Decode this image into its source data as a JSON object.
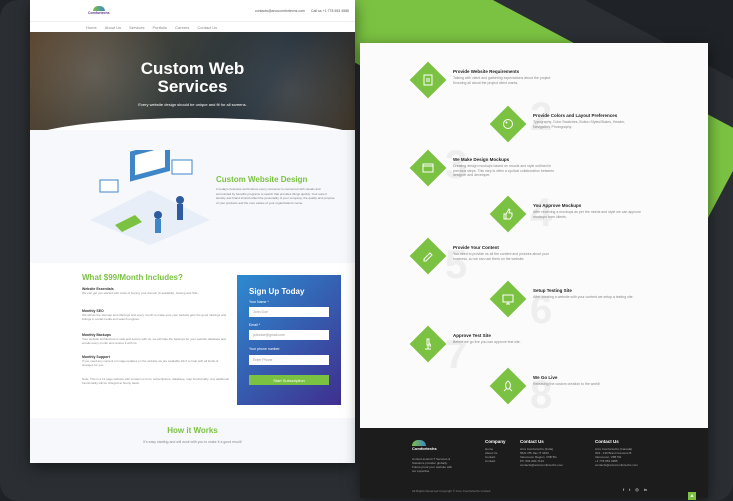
{
  "top": {
    "logo_text": "Comfortechs",
    "email": "contacts@arcocomfortechs.com",
    "phone": "Call us +1 778 953 4985",
    "nav": [
      "Home",
      "About Us",
      "Services",
      "Portfolio",
      "Careers",
      "Contact Us"
    ]
  },
  "hero": {
    "title": "Custom Web Services",
    "subtitle": "Every website design should be unique and fit for all screens."
  },
  "intro": {
    "title": "Custom Website Design",
    "text": "In today's business world where every consumer is concerned with visuals and surrounded by benefits programs to search that provides things quickly. Your expert identity and brand should reflect the personality of your company, the quality and purpose of your products and the core values of your organization's name."
  },
  "includes": {
    "title": "What $99/Month Includes?",
    "features": [
      {
        "name": "Website Essentials",
        "text": "We can get you started with costs of buying your domain (if available), hosting and SSL."
      },
      {
        "name": "Monthly SEO",
        "text": "We will do the sitemap and offerings and every month to make sure your website gets the good rankings and listings in social media and search engines."
      },
      {
        "name": "Monthly Backups",
        "text": "Your website architecture is safe and secure with us, we will take the backups for your website database and emails every month and restore it with us."
      },
      {
        "name": "Monthly Support",
        "text": "If you need any content or image updates on the website we are available 24x7 to help with all kinds of changes for you."
      }
    ],
    "note": "Note: This is a 12 page website with contact us form, subscriptions, database, map functionality. Any additional functionality will be charged at hourly basis."
  },
  "signup": {
    "title": "Sign Up Today",
    "name_label": "Your Name *",
    "name_value": "John Doe",
    "email_label": "Email *",
    "email_value": "johndoe@gmail.com",
    "phone_label": "Your phone number",
    "phone_value": "Enter Phone",
    "button": "Start Subscription"
  },
  "how": {
    "title": "How it Works",
    "subtitle": "It's easy starting and will work with you to make it a good result!"
  },
  "steps": [
    {
      "num": "1",
      "title": "Provide Website Requirements",
      "text": "Talking with client and gathering expectations about the project. Knowing all about the project client wants."
    },
    {
      "num": "2",
      "title": "Provide Colors and Layout Preferences",
      "text": "Typography, Color Swatches, Button Styles/States, Header, Navigation, Photography."
    },
    {
      "num": "3",
      "title": "We Make Design Mockups",
      "text": "Creating design mockups based on moods and style outlined in previous steps. This step is often a cyclical collaboration between designer and developer."
    },
    {
      "num": "4",
      "title": "You Approve Mockups",
      "text": "After receiving a mockups as per the needs and style we can approve mockups from clients."
    },
    {
      "num": "5",
      "title": "Provide Your Content",
      "text": "You need to provide us all the content and pictures about your business, so we can use them on the website."
    },
    {
      "num": "6",
      "title": "Setup Testing Site",
      "text": "After creating a website with your content we setup a testing site."
    },
    {
      "num": "7",
      "title": "Approve Test Site",
      "text": "Before we go live you can approve test site."
    },
    {
      "num": "8",
      "title": "We Go Live",
      "text": "Releasing the custom creation to the world!"
    }
  ],
  "footer": {
    "logo_text": "Comfortechs",
    "tagline": "An End-to-End IT Services & Solutions provider globally. Future proof your website with our expertise",
    "company_title": "Company",
    "company_links": [
      "Home",
      "About Us",
      "Contact",
      "Contact"
    ],
    "contact_title": "Contact Us",
    "contact_lines": [
      "Arcs Comfortechs (India)",
      "5521 PB Jaio IT 3400",
      "Vancouver Region, V6B 5f1",
      "Ph: 604-600-7122",
      "contacts@arcocomfortechs.com"
    ],
    "contact2_title": "Contact Us",
    "contact2_lines": [
      "Arcs Comfortechs (Canada)",
      "303 - 130 Brant Crescent B",
      "Vancouver, V6B 5f1",
      "+1 778 953 4985",
      "contacts@arcocomfortechs.com"
    ],
    "copyright": "All Rights Reserved Copyright © Arco Comfortechs Limited",
    "social": [
      "f",
      "t",
      "◎",
      "in"
    ]
  },
  "colors": {
    "accent": "#7bc242",
    "dark": "#1c1c1c",
    "brand_blue": "#3f86c9"
  }
}
